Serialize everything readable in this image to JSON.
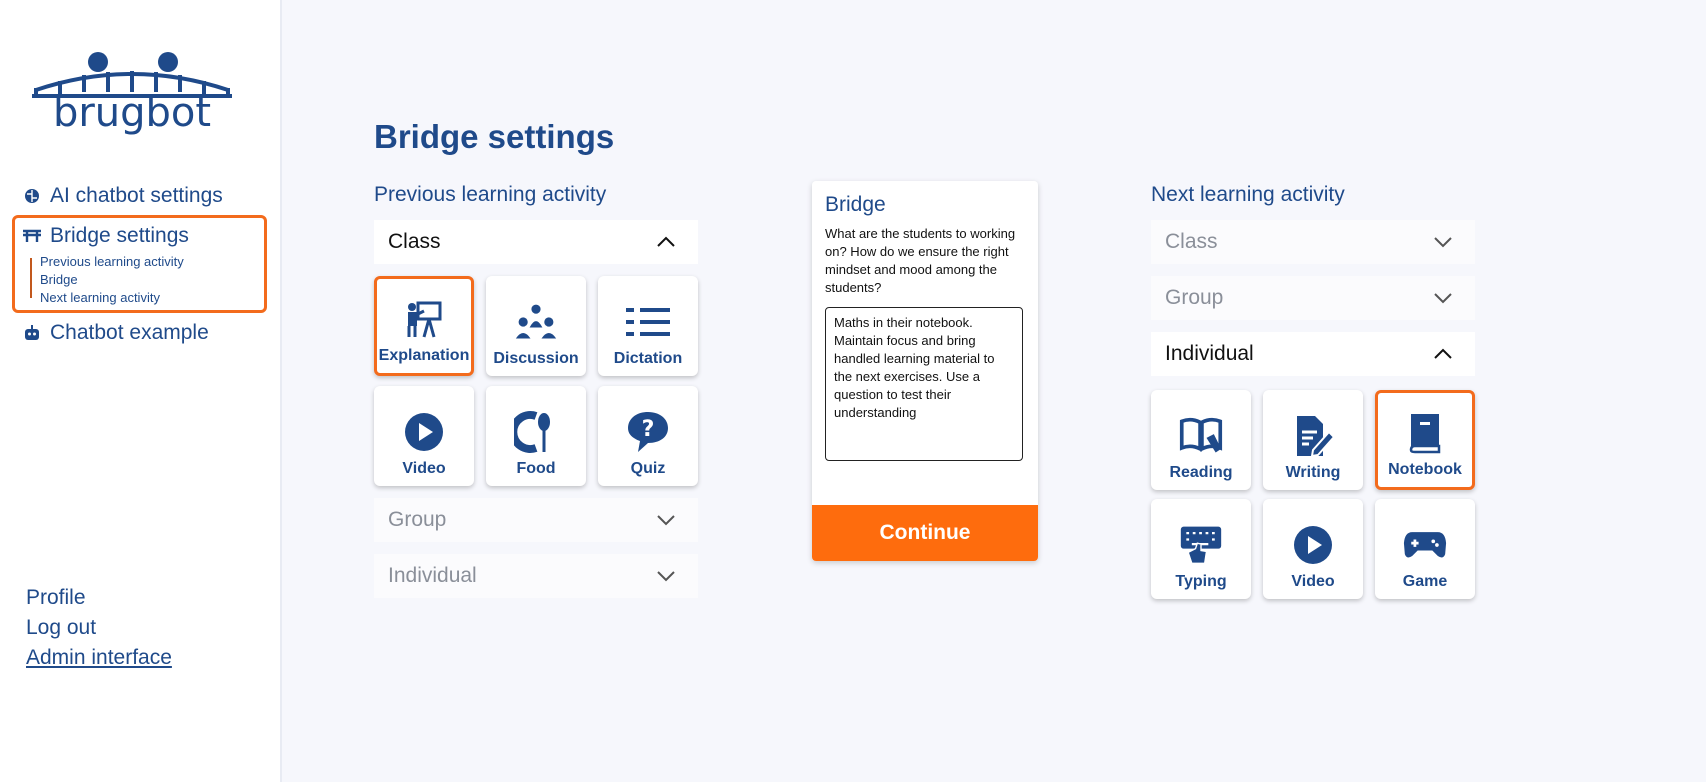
{
  "sidebar": {
    "logo_text": "brugbot",
    "nav": [
      {
        "label": "AI chatbot settings",
        "icon": "brain-icon"
      },
      {
        "label": "Bridge settings",
        "icon": "bridge-icon"
      },
      {
        "label": "Chatbot example",
        "icon": "robot-icon"
      }
    ],
    "sub_items": [
      "Previous learning activity",
      "Bridge",
      "Next learning activity"
    ],
    "bottom": {
      "profile": "Profile",
      "logout": "Log out",
      "admin": "Admin interface"
    }
  },
  "main": {
    "title": "Bridge settings",
    "previous": {
      "title": "Previous learning activity",
      "class": "Class",
      "group": "Group",
      "individual": "Individual",
      "tiles": [
        {
          "label": "Explanation",
          "icon": "teacher-board-icon",
          "selected": true
        },
        {
          "label": "Discussion",
          "icon": "group-people-icon",
          "selected": false
        },
        {
          "label": "Dictation",
          "icon": "list-lines-icon",
          "selected": false
        },
        {
          "label": "Video",
          "icon": "play-icon",
          "selected": false
        },
        {
          "label": "Food",
          "icon": "food-icon",
          "selected": false
        },
        {
          "label": "Quiz",
          "icon": "question-icon",
          "selected": false
        }
      ]
    },
    "bridge": {
      "title": "Bridge",
      "question": "What are the students  to working on? How do we ensure the right mindset and mood among the students?",
      "text": "Maths in their notebook. Maintain focus and bring handled learning material to the next exercises. Use a question to test their understanding",
      "continue": "Continue"
    },
    "next": {
      "title": "Next learning activity",
      "class": "Class",
      "group": "Group",
      "individual": "Individual",
      "tiles": [
        {
          "label": "Reading",
          "icon": "book-open-icon",
          "selected": false
        },
        {
          "label": "Writing",
          "icon": "pen-document-icon",
          "selected": false
        },
        {
          "label": "Notebook",
          "icon": "notebook-icon",
          "selected": true
        },
        {
          "label": "Typing",
          "icon": "keyboard-icon",
          "selected": false
        },
        {
          "label": "Video",
          "icon": "play-icon",
          "selected": false
        },
        {
          "label": "Game",
          "icon": "gamepad-icon",
          "selected": false
        }
      ]
    }
  },
  "colors": {
    "primary": "#1f4a8a",
    "accent": "#f36b1c",
    "button": "#fe6c0d"
  }
}
